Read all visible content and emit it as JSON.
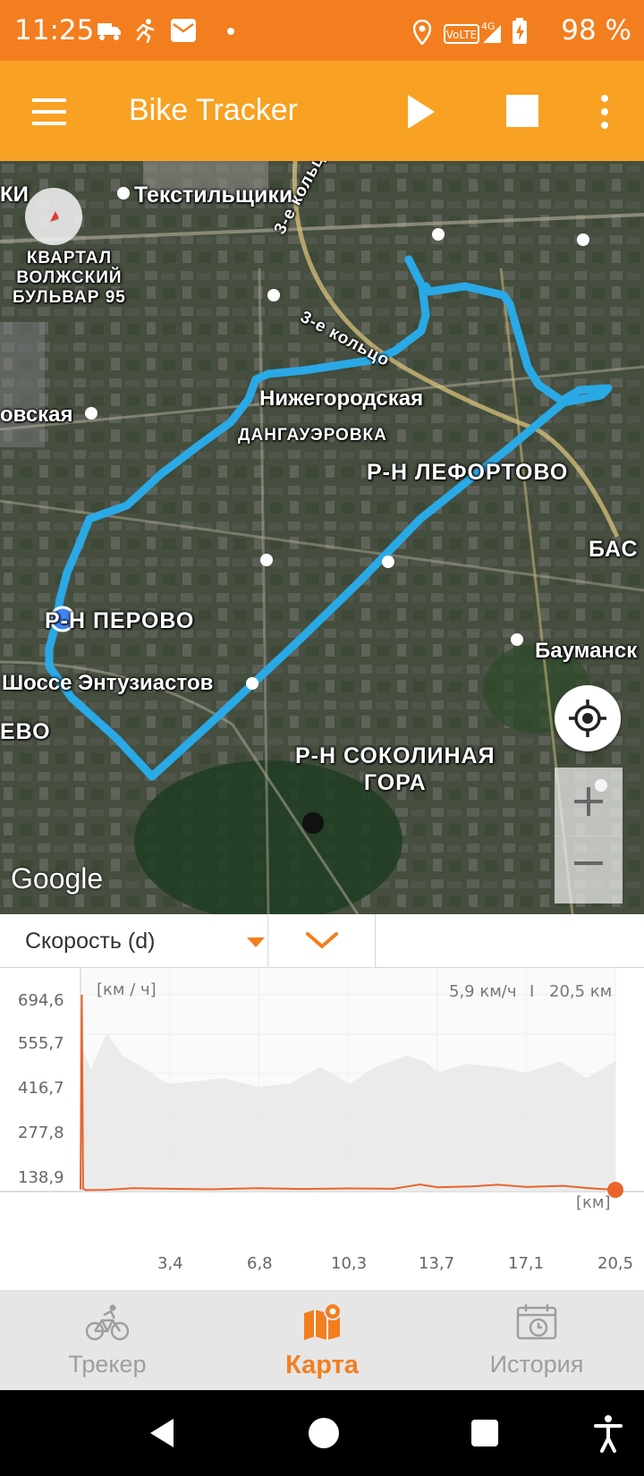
{
  "status_bar": {
    "time": "11:25",
    "battery_percent": "98 %",
    "network_label": "VoLTE 4G",
    "icons": [
      "truck-icon",
      "runner-icon",
      "mail-icon",
      "dot-icon",
      "location-icon",
      "volte-icon",
      "signal-icon",
      "battery-charging-icon"
    ]
  },
  "app_bar": {
    "title": "Bike Tracker",
    "background": "#f8a123"
  },
  "map": {
    "labels": {
      "tekstilshchiki": "Текстильщики",
      "ki": "КИ",
      "kvartal": "КВАРТАЛ\nВОЛЖСКИЙ\nБУЛЬВАР 95",
      "ring1": "3-е кольцо",
      "ring2": "3-е кольцо",
      "nizhegorodskaya": "Нижегородская",
      "dangauerovka": "ДАНГАУЭРОВКА",
      "ovskaya": "овская",
      "lefortovo": "Р-Н ЛЕФОРТОВО",
      "bas": "БАС",
      "perovo": "Р-Н ПЕРОВО",
      "baumanskaya": "Бауманск",
      "shosse": "Шоссе Энтузиастов",
      "evo": "ЕВО",
      "sokolinaya": "Р-Н СОКОЛИНАЯ\nГОРА"
    },
    "attribution": "Google",
    "route_color": "#29a9e6"
  },
  "chart_panel": {
    "selector_label": "Скорость (d)",
    "y_unit": "[км / ч]",
    "x_unit": "[км]",
    "readout_speed": "5,9 км/ч",
    "readout_separator": "I",
    "readout_distance": "20,5 км",
    "y_ticks": [
      "694,6",
      "555,7",
      "416,7",
      "277,8",
      "138,9"
    ],
    "x_ticks": [
      "3,4",
      "6,8",
      "10,3",
      "13,7",
      "17,1",
      "20,5"
    ]
  },
  "chart_data": {
    "type": "line",
    "xlabel": "[км]",
    "ylabel": "[км / ч]",
    "xlim": [
      0,
      20.5
    ],
    "ylim": [
      0,
      694.6
    ],
    "series": [
      {
        "color": "#e8642c",
        "x": [
          0,
          0.05,
          0.1,
          0.2,
          1.0,
          2.0,
          3.4,
          5.0,
          6.8,
          8.5,
          10.3,
          12.0,
          13.0,
          13.7,
          15.0,
          16.0,
          17.1,
          18.5,
          19.5,
          20.5
        ],
        "y": [
          8,
          694.6,
          10,
          5,
          6,
          12,
          10,
          8,
          12,
          9,
          11,
          10,
          25,
          15,
          18,
          24,
          16,
          20,
          12,
          5.9
        ]
      }
    ],
    "background_series": {
      "color": "#e9e9e9",
      "x": [
        0,
        0.4,
        1.0,
        1.6,
        2.2,
        3.0,
        3.4,
        4.5,
        5.5,
        6.8,
        8.0,
        9.2,
        10.3,
        11.3,
        12.5,
        13.2,
        13.7,
        14.8,
        16.0,
        17.1,
        18.4,
        19.4,
        20.5
      ],
      "y": [
        520,
        430,
        560,
        480,
        450,
        400,
        380,
        390,
        400,
        370,
        380,
        440,
        380,
        440,
        480,
        460,
        420,
        450,
        440,
        420,
        460,
        400,
        460
      ]
    },
    "marker": {
      "x": 20.5,
      "y": 5.9,
      "color": "#e8642c"
    },
    "grid": true
  },
  "bottom_nav": {
    "items": [
      {
        "label": "Трекер",
        "icon": "bicycle-icon",
        "active": false
      },
      {
        "label": "Карта",
        "icon": "map-pin-icon",
        "active": true
      },
      {
        "label": "История",
        "icon": "calendar-clock-icon",
        "active": false
      }
    ],
    "active_color": "#f37e1f"
  },
  "system_nav": {
    "buttons": [
      "back-icon",
      "home-icon",
      "recents-icon",
      "accessibility-icon"
    ]
  }
}
